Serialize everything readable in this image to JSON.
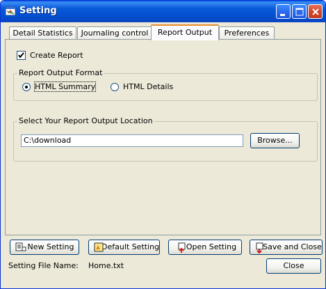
{
  "window": {
    "title": "Setting"
  },
  "tabs": [
    {
      "label": "Detail Statistics"
    },
    {
      "label": "Journaling control"
    },
    {
      "label": "Report Output"
    },
    {
      "label": "Preferences"
    }
  ],
  "report_output": {
    "create_report_label": "Create Report",
    "create_report_checked": true,
    "format_group_title": "Report Output Format",
    "format_options": [
      {
        "label": "HTML Summary",
        "selected": true
      },
      {
        "label": "HTML Details",
        "selected": false
      }
    ],
    "location_group_title": "Select Your Report Output Location",
    "location_value": "C:\\download",
    "browse_label": "Browse..."
  },
  "bottom_buttons": {
    "new_setting": "New Setting",
    "default_setting": "Default Setting",
    "open_setting": "Open Setting",
    "save_and_close": "Save and Close",
    "close": "Close"
  },
  "footer": {
    "file_name_label": "Setting File Name:",
    "file_name_value": "Home.txt"
  }
}
